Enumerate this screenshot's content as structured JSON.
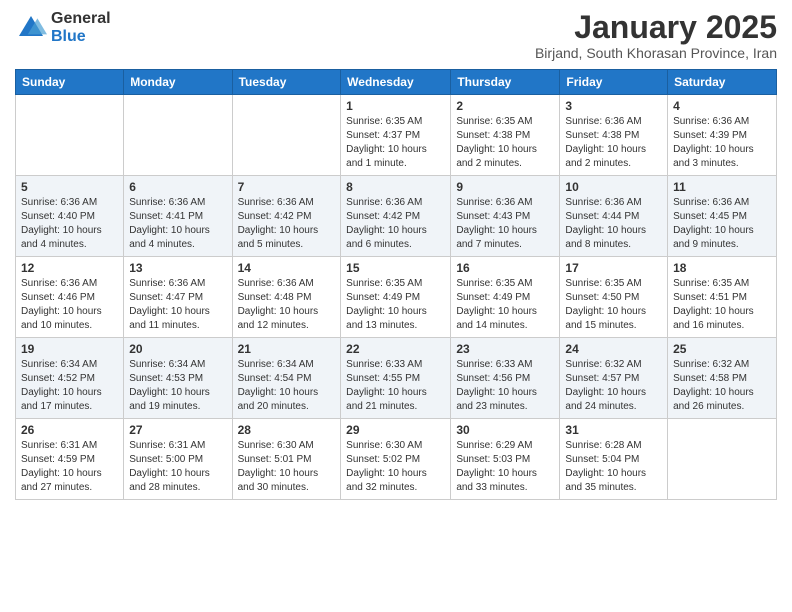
{
  "logo": {
    "general": "General",
    "blue": "Blue"
  },
  "title": "January 2025",
  "subtitle": "Birjand, South Khorasan Province, Iran",
  "weekdays": [
    "Sunday",
    "Monday",
    "Tuesday",
    "Wednesday",
    "Thursday",
    "Friday",
    "Saturday"
  ],
  "weeks": [
    [
      {
        "day": "",
        "info": ""
      },
      {
        "day": "",
        "info": ""
      },
      {
        "day": "",
        "info": ""
      },
      {
        "day": "1",
        "info": "Sunrise: 6:35 AM\nSunset: 4:37 PM\nDaylight: 10 hours\nand 1 minute."
      },
      {
        "day": "2",
        "info": "Sunrise: 6:35 AM\nSunset: 4:38 PM\nDaylight: 10 hours\nand 2 minutes."
      },
      {
        "day": "3",
        "info": "Sunrise: 6:36 AM\nSunset: 4:38 PM\nDaylight: 10 hours\nand 2 minutes."
      },
      {
        "day": "4",
        "info": "Sunrise: 6:36 AM\nSunset: 4:39 PM\nDaylight: 10 hours\nand 3 minutes."
      }
    ],
    [
      {
        "day": "5",
        "info": "Sunrise: 6:36 AM\nSunset: 4:40 PM\nDaylight: 10 hours\nand 4 minutes."
      },
      {
        "day": "6",
        "info": "Sunrise: 6:36 AM\nSunset: 4:41 PM\nDaylight: 10 hours\nand 4 minutes."
      },
      {
        "day": "7",
        "info": "Sunrise: 6:36 AM\nSunset: 4:42 PM\nDaylight: 10 hours\nand 5 minutes."
      },
      {
        "day": "8",
        "info": "Sunrise: 6:36 AM\nSunset: 4:42 PM\nDaylight: 10 hours\nand 6 minutes."
      },
      {
        "day": "9",
        "info": "Sunrise: 6:36 AM\nSunset: 4:43 PM\nDaylight: 10 hours\nand 7 minutes."
      },
      {
        "day": "10",
        "info": "Sunrise: 6:36 AM\nSunset: 4:44 PM\nDaylight: 10 hours\nand 8 minutes."
      },
      {
        "day": "11",
        "info": "Sunrise: 6:36 AM\nSunset: 4:45 PM\nDaylight: 10 hours\nand 9 minutes."
      }
    ],
    [
      {
        "day": "12",
        "info": "Sunrise: 6:36 AM\nSunset: 4:46 PM\nDaylight: 10 hours\nand 10 minutes."
      },
      {
        "day": "13",
        "info": "Sunrise: 6:36 AM\nSunset: 4:47 PM\nDaylight: 10 hours\nand 11 minutes."
      },
      {
        "day": "14",
        "info": "Sunrise: 6:36 AM\nSunset: 4:48 PM\nDaylight: 10 hours\nand 12 minutes."
      },
      {
        "day": "15",
        "info": "Sunrise: 6:35 AM\nSunset: 4:49 PM\nDaylight: 10 hours\nand 13 minutes."
      },
      {
        "day": "16",
        "info": "Sunrise: 6:35 AM\nSunset: 4:49 PM\nDaylight: 10 hours\nand 14 minutes."
      },
      {
        "day": "17",
        "info": "Sunrise: 6:35 AM\nSunset: 4:50 PM\nDaylight: 10 hours\nand 15 minutes."
      },
      {
        "day": "18",
        "info": "Sunrise: 6:35 AM\nSunset: 4:51 PM\nDaylight: 10 hours\nand 16 minutes."
      }
    ],
    [
      {
        "day": "19",
        "info": "Sunrise: 6:34 AM\nSunset: 4:52 PM\nDaylight: 10 hours\nand 17 minutes."
      },
      {
        "day": "20",
        "info": "Sunrise: 6:34 AM\nSunset: 4:53 PM\nDaylight: 10 hours\nand 19 minutes."
      },
      {
        "day": "21",
        "info": "Sunrise: 6:34 AM\nSunset: 4:54 PM\nDaylight: 10 hours\nand 20 minutes."
      },
      {
        "day": "22",
        "info": "Sunrise: 6:33 AM\nSunset: 4:55 PM\nDaylight: 10 hours\nand 21 minutes."
      },
      {
        "day": "23",
        "info": "Sunrise: 6:33 AM\nSunset: 4:56 PM\nDaylight: 10 hours\nand 23 minutes."
      },
      {
        "day": "24",
        "info": "Sunrise: 6:32 AM\nSunset: 4:57 PM\nDaylight: 10 hours\nand 24 minutes."
      },
      {
        "day": "25",
        "info": "Sunrise: 6:32 AM\nSunset: 4:58 PM\nDaylight: 10 hours\nand 26 minutes."
      }
    ],
    [
      {
        "day": "26",
        "info": "Sunrise: 6:31 AM\nSunset: 4:59 PM\nDaylight: 10 hours\nand 27 minutes."
      },
      {
        "day": "27",
        "info": "Sunrise: 6:31 AM\nSunset: 5:00 PM\nDaylight: 10 hours\nand 28 minutes."
      },
      {
        "day": "28",
        "info": "Sunrise: 6:30 AM\nSunset: 5:01 PM\nDaylight: 10 hours\nand 30 minutes."
      },
      {
        "day": "29",
        "info": "Sunrise: 6:30 AM\nSunset: 5:02 PM\nDaylight: 10 hours\nand 32 minutes."
      },
      {
        "day": "30",
        "info": "Sunrise: 6:29 AM\nSunset: 5:03 PM\nDaylight: 10 hours\nand 33 minutes."
      },
      {
        "day": "31",
        "info": "Sunrise: 6:28 AM\nSunset: 5:04 PM\nDaylight: 10 hours\nand 35 minutes."
      },
      {
        "day": "",
        "info": ""
      }
    ]
  ]
}
